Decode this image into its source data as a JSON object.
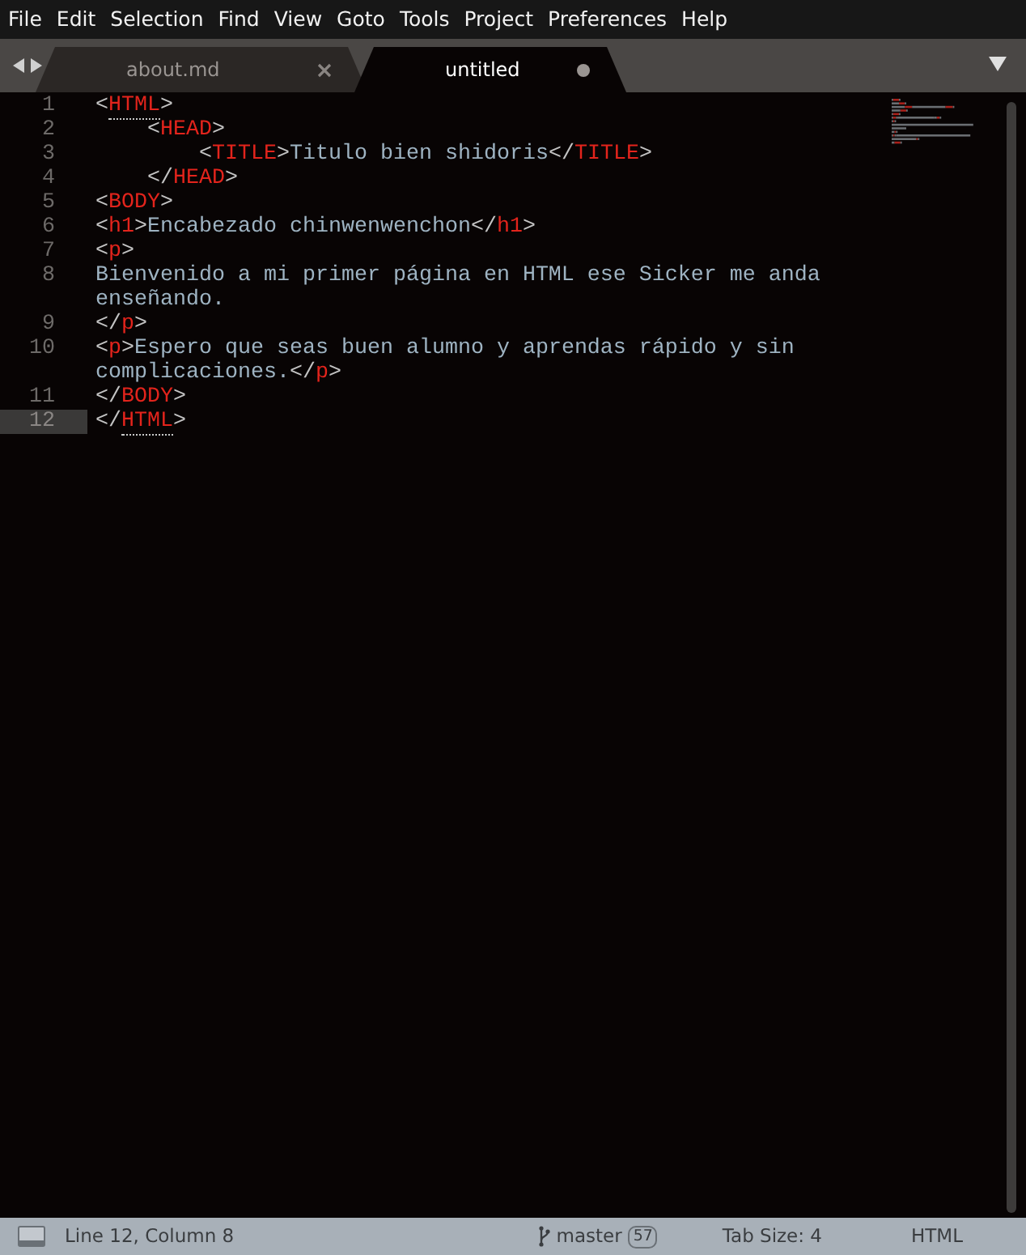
{
  "menu": [
    "File",
    "Edit",
    "Selection",
    "Find",
    "View",
    "Goto",
    "Tools",
    "Project",
    "Preferences",
    "Help"
  ],
  "tabs": [
    {
      "label": "about.md",
      "selected": false,
      "dirty": false
    },
    {
      "label": "untitled",
      "selected": true,
      "dirty": true
    }
  ],
  "lines": [
    {
      "number": "1",
      "current": false,
      "rows": [
        {
          "tokens": [
            {
              "kind": "punct",
              "text": "<"
            },
            {
              "kind": "tag",
              "text": "HTML",
              "matched": true
            },
            {
              "kind": "punct",
              "text": ">"
            }
          ]
        }
      ]
    },
    {
      "number": "2",
      "current": false,
      "rows": [
        {
          "tokens": [
            {
              "kind": "punct",
              "text": "    <"
            },
            {
              "kind": "tag",
              "text": "HEAD"
            },
            {
              "kind": "punct",
              "text": ">"
            }
          ]
        }
      ]
    },
    {
      "number": "3",
      "current": false,
      "rows": [
        {
          "tokens": [
            {
              "kind": "punct",
              "text": "        <"
            },
            {
              "kind": "tag",
              "text": "TITLE"
            },
            {
              "kind": "punct",
              "text": ">"
            },
            {
              "kind": "content",
              "text": "Titulo bien shidoris"
            },
            {
              "kind": "punct",
              "text": "</"
            },
            {
              "kind": "tag",
              "text": "TITLE"
            },
            {
              "kind": "punct",
              "text": ">"
            }
          ]
        }
      ]
    },
    {
      "number": "4",
      "current": false,
      "rows": [
        {
          "tokens": [
            {
              "kind": "punct",
              "text": "    </"
            },
            {
              "kind": "tag",
              "text": "HEAD"
            },
            {
              "kind": "punct",
              "text": ">"
            }
          ]
        }
      ]
    },
    {
      "number": "5",
      "current": false,
      "rows": [
        {
          "tokens": [
            {
              "kind": "punct",
              "text": "<"
            },
            {
              "kind": "tag",
              "text": "BODY"
            },
            {
              "kind": "punct",
              "text": ">"
            }
          ]
        }
      ]
    },
    {
      "number": "6",
      "current": false,
      "rows": [
        {
          "tokens": [
            {
              "kind": "punct",
              "text": "<"
            },
            {
              "kind": "tag",
              "text": "h1"
            },
            {
              "kind": "punct",
              "text": ">"
            },
            {
              "kind": "content",
              "text": "Encabezado chinwenwenchon"
            },
            {
              "kind": "punct",
              "text": "</"
            },
            {
              "kind": "tag",
              "text": "h1"
            },
            {
              "kind": "punct",
              "text": ">"
            }
          ]
        }
      ]
    },
    {
      "number": "7",
      "current": false,
      "rows": [
        {
          "tokens": [
            {
              "kind": "punct",
              "text": "<"
            },
            {
              "kind": "tag",
              "text": "p"
            },
            {
              "kind": "punct",
              "text": ">"
            }
          ]
        }
      ]
    },
    {
      "number": "8",
      "current": false,
      "rows": [
        {
          "tokens": [
            {
              "kind": "content",
              "text": "Bienvenido a mi primer página en HTML ese Sicker me anda"
            }
          ]
        },
        {
          "tokens": [
            {
              "kind": "content",
              "text": "enseñando."
            }
          ]
        }
      ]
    },
    {
      "number": "9",
      "current": false,
      "rows": [
        {
          "tokens": [
            {
              "kind": "punct",
              "text": "</"
            },
            {
              "kind": "tag",
              "text": "p"
            },
            {
              "kind": "punct",
              "text": ">"
            }
          ]
        }
      ]
    },
    {
      "number": "10",
      "current": false,
      "rows": [
        {
          "tokens": [
            {
              "kind": "punct",
              "text": "<"
            },
            {
              "kind": "tag",
              "text": "p"
            },
            {
              "kind": "punct",
              "text": ">"
            },
            {
              "kind": "content",
              "text": "Espero que seas buen alumno y aprendas rápido y sin"
            }
          ]
        },
        {
          "tokens": [
            {
              "kind": "content",
              "text": "complicaciones."
            },
            {
              "kind": "punct",
              "text": "</"
            },
            {
              "kind": "tag",
              "text": "p"
            },
            {
              "kind": "punct",
              "text": ">"
            }
          ]
        }
      ]
    },
    {
      "number": "11",
      "current": false,
      "rows": [
        {
          "tokens": [
            {
              "kind": "punct",
              "text": "</"
            },
            {
              "kind": "tag",
              "text": "BODY"
            },
            {
              "kind": "punct",
              "text": ">"
            }
          ]
        }
      ]
    },
    {
      "number": "12",
      "current": true,
      "rows": [
        {
          "tokens": [
            {
              "kind": "punct",
              "text": "</"
            },
            {
              "kind": "tag",
              "text": "HTML",
              "matched": true
            },
            {
              "kind": "punct",
              "text": ">"
            }
          ]
        }
      ]
    }
  ],
  "status_bar": {
    "position": "Line 12, Column 8",
    "branch": "master",
    "changes": "57",
    "tab_size": "Tab Size: 4",
    "syntax": "HTML"
  }
}
